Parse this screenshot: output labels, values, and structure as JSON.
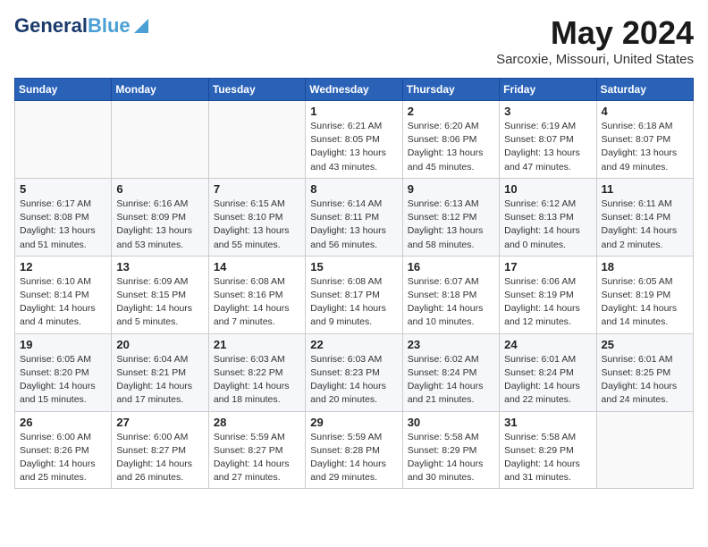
{
  "header": {
    "logo_general": "General",
    "logo_blue": "Blue",
    "title": "May 2024",
    "subtitle": "Sarcoxie, Missouri, United States"
  },
  "weekdays": [
    "Sunday",
    "Monday",
    "Tuesday",
    "Wednesday",
    "Thursday",
    "Friday",
    "Saturday"
  ],
  "weeks": [
    [
      {
        "day": "",
        "info": ""
      },
      {
        "day": "",
        "info": ""
      },
      {
        "day": "",
        "info": ""
      },
      {
        "day": "1",
        "info": "Sunrise: 6:21 AM\nSunset: 8:05 PM\nDaylight: 13 hours\nand 43 minutes."
      },
      {
        "day": "2",
        "info": "Sunrise: 6:20 AM\nSunset: 8:06 PM\nDaylight: 13 hours\nand 45 minutes."
      },
      {
        "day": "3",
        "info": "Sunrise: 6:19 AM\nSunset: 8:07 PM\nDaylight: 13 hours\nand 47 minutes."
      },
      {
        "day": "4",
        "info": "Sunrise: 6:18 AM\nSunset: 8:07 PM\nDaylight: 13 hours\nand 49 minutes."
      }
    ],
    [
      {
        "day": "5",
        "info": "Sunrise: 6:17 AM\nSunset: 8:08 PM\nDaylight: 13 hours\nand 51 minutes."
      },
      {
        "day": "6",
        "info": "Sunrise: 6:16 AM\nSunset: 8:09 PM\nDaylight: 13 hours\nand 53 minutes."
      },
      {
        "day": "7",
        "info": "Sunrise: 6:15 AM\nSunset: 8:10 PM\nDaylight: 13 hours\nand 55 minutes."
      },
      {
        "day": "8",
        "info": "Sunrise: 6:14 AM\nSunset: 8:11 PM\nDaylight: 13 hours\nand 56 minutes."
      },
      {
        "day": "9",
        "info": "Sunrise: 6:13 AM\nSunset: 8:12 PM\nDaylight: 13 hours\nand 58 minutes."
      },
      {
        "day": "10",
        "info": "Sunrise: 6:12 AM\nSunset: 8:13 PM\nDaylight: 14 hours\nand 0 minutes."
      },
      {
        "day": "11",
        "info": "Sunrise: 6:11 AM\nSunset: 8:14 PM\nDaylight: 14 hours\nand 2 minutes."
      }
    ],
    [
      {
        "day": "12",
        "info": "Sunrise: 6:10 AM\nSunset: 8:14 PM\nDaylight: 14 hours\nand 4 minutes."
      },
      {
        "day": "13",
        "info": "Sunrise: 6:09 AM\nSunset: 8:15 PM\nDaylight: 14 hours\nand 5 minutes."
      },
      {
        "day": "14",
        "info": "Sunrise: 6:08 AM\nSunset: 8:16 PM\nDaylight: 14 hours\nand 7 minutes."
      },
      {
        "day": "15",
        "info": "Sunrise: 6:08 AM\nSunset: 8:17 PM\nDaylight: 14 hours\nand 9 minutes."
      },
      {
        "day": "16",
        "info": "Sunrise: 6:07 AM\nSunset: 8:18 PM\nDaylight: 14 hours\nand 10 minutes."
      },
      {
        "day": "17",
        "info": "Sunrise: 6:06 AM\nSunset: 8:19 PM\nDaylight: 14 hours\nand 12 minutes."
      },
      {
        "day": "18",
        "info": "Sunrise: 6:05 AM\nSunset: 8:19 PM\nDaylight: 14 hours\nand 14 minutes."
      }
    ],
    [
      {
        "day": "19",
        "info": "Sunrise: 6:05 AM\nSunset: 8:20 PM\nDaylight: 14 hours\nand 15 minutes."
      },
      {
        "day": "20",
        "info": "Sunrise: 6:04 AM\nSunset: 8:21 PM\nDaylight: 14 hours\nand 17 minutes."
      },
      {
        "day": "21",
        "info": "Sunrise: 6:03 AM\nSunset: 8:22 PM\nDaylight: 14 hours\nand 18 minutes."
      },
      {
        "day": "22",
        "info": "Sunrise: 6:03 AM\nSunset: 8:23 PM\nDaylight: 14 hours\nand 20 minutes."
      },
      {
        "day": "23",
        "info": "Sunrise: 6:02 AM\nSunset: 8:24 PM\nDaylight: 14 hours\nand 21 minutes."
      },
      {
        "day": "24",
        "info": "Sunrise: 6:01 AM\nSunset: 8:24 PM\nDaylight: 14 hours\nand 22 minutes."
      },
      {
        "day": "25",
        "info": "Sunrise: 6:01 AM\nSunset: 8:25 PM\nDaylight: 14 hours\nand 24 minutes."
      }
    ],
    [
      {
        "day": "26",
        "info": "Sunrise: 6:00 AM\nSunset: 8:26 PM\nDaylight: 14 hours\nand 25 minutes."
      },
      {
        "day": "27",
        "info": "Sunrise: 6:00 AM\nSunset: 8:27 PM\nDaylight: 14 hours\nand 26 minutes."
      },
      {
        "day": "28",
        "info": "Sunrise: 5:59 AM\nSunset: 8:27 PM\nDaylight: 14 hours\nand 27 minutes."
      },
      {
        "day": "29",
        "info": "Sunrise: 5:59 AM\nSunset: 8:28 PM\nDaylight: 14 hours\nand 29 minutes."
      },
      {
        "day": "30",
        "info": "Sunrise: 5:58 AM\nSunset: 8:29 PM\nDaylight: 14 hours\nand 30 minutes."
      },
      {
        "day": "31",
        "info": "Sunrise: 5:58 AM\nSunset: 8:29 PM\nDaylight: 14 hours\nand 31 minutes."
      },
      {
        "day": "",
        "info": ""
      }
    ]
  ]
}
